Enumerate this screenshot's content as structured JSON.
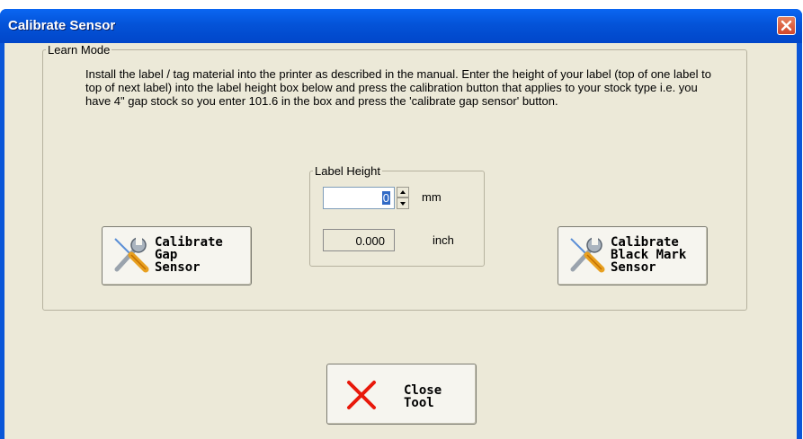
{
  "dialog": {
    "title": "Calibrate Sensor",
    "learn_mode": {
      "legend": "Learn Mode",
      "instructions": "Install the label / tag material into the printer as described in the manual. Enter the height of your label (top of one label to top of next label) into the label height box below and press the calibration button that applies to your stock type i.e. you have 4\" gap stock so you enter 101.6 in the box and press the 'calibrate gap sensor' button."
    },
    "label_height": {
      "legend": "Label Height",
      "mm_value": "0",
      "mm_unit": "mm",
      "inch_value": "0.000",
      "inch_unit": "inch"
    },
    "buttons": {
      "calibrate_gap": "Calibrate\nGap\nSensor",
      "calibrate_black_mark": "Calibrate\nBlack Mark\nSensor",
      "close_tool": "Close\nTool"
    }
  },
  "icons": {
    "close": "close-icon",
    "tools": "wrench-screwdriver-icon",
    "x_mark": "red-x-icon"
  },
  "colors": {
    "titlebar": "#0453d8",
    "dialog_background": "#ece9d8",
    "close_button": "#d2462b",
    "x_mark": "#e8180a"
  }
}
